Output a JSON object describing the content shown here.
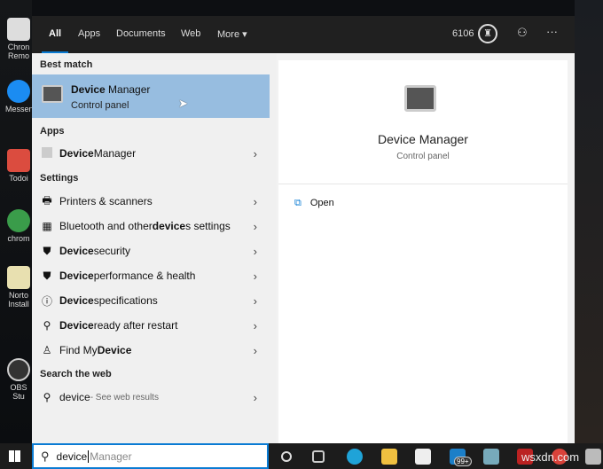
{
  "desktop": {
    "icons": [
      {
        "label": "Chron Remo"
      },
      {
        "label": "Messen"
      },
      {
        "label": "Todoi"
      },
      {
        "label": "chrom"
      },
      {
        "label": "Norto Install"
      },
      {
        "label": "OBS Stu"
      }
    ]
  },
  "header": {
    "tabs": [
      "All",
      "Apps",
      "Documents",
      "Web",
      "More"
    ],
    "points": "6106"
  },
  "best_match": {
    "heading": "Best match",
    "title": "Device Manager",
    "title_bold": "Device",
    "title_rest": " Manager",
    "subtitle": "Control panel"
  },
  "apps": {
    "heading": "Apps",
    "items": [
      {
        "bold": "Device",
        "rest": " Manager"
      }
    ]
  },
  "settings": {
    "heading": "Settings",
    "items": [
      {
        "icon": "printer-icon",
        "glyph": "🖶",
        "pre": "Printers & scanners",
        "bold": "",
        "post": ""
      },
      {
        "icon": "bluetooth-devices-icon",
        "glyph": "▦",
        "pre": "Bluetooth and other ",
        "bold": "device",
        "post": "s settings"
      },
      {
        "icon": "shield-icon",
        "glyph": "⛊",
        "pre": "",
        "bold": "Device",
        "post": " security"
      },
      {
        "icon": "shield-icon",
        "glyph": "⛊",
        "pre": "",
        "bold": "Device",
        "post": " performance & health"
      },
      {
        "icon": "info-icon",
        "glyph": "ⓘ",
        "pre": "",
        "bold": "Device",
        "post": " specifications"
      },
      {
        "icon": "key-icon",
        "glyph": "⚲",
        "pre": "",
        "bold": "Device",
        "post": " ready after restart"
      },
      {
        "icon": "find-device-icon",
        "glyph": "♙",
        "pre": "Find My ",
        "bold": "Device",
        "post": ""
      }
    ]
  },
  "web": {
    "heading": "Search the web",
    "query": "device",
    "suffix": " - See web results"
  },
  "preview": {
    "title": "Device Manager",
    "subtitle": "Control panel",
    "action": "Open"
  },
  "search": {
    "typed": "device",
    "suggestion": "Manager"
  },
  "taskbar": {
    "badge": "99+"
  },
  "watermark": "wsxdn.com"
}
